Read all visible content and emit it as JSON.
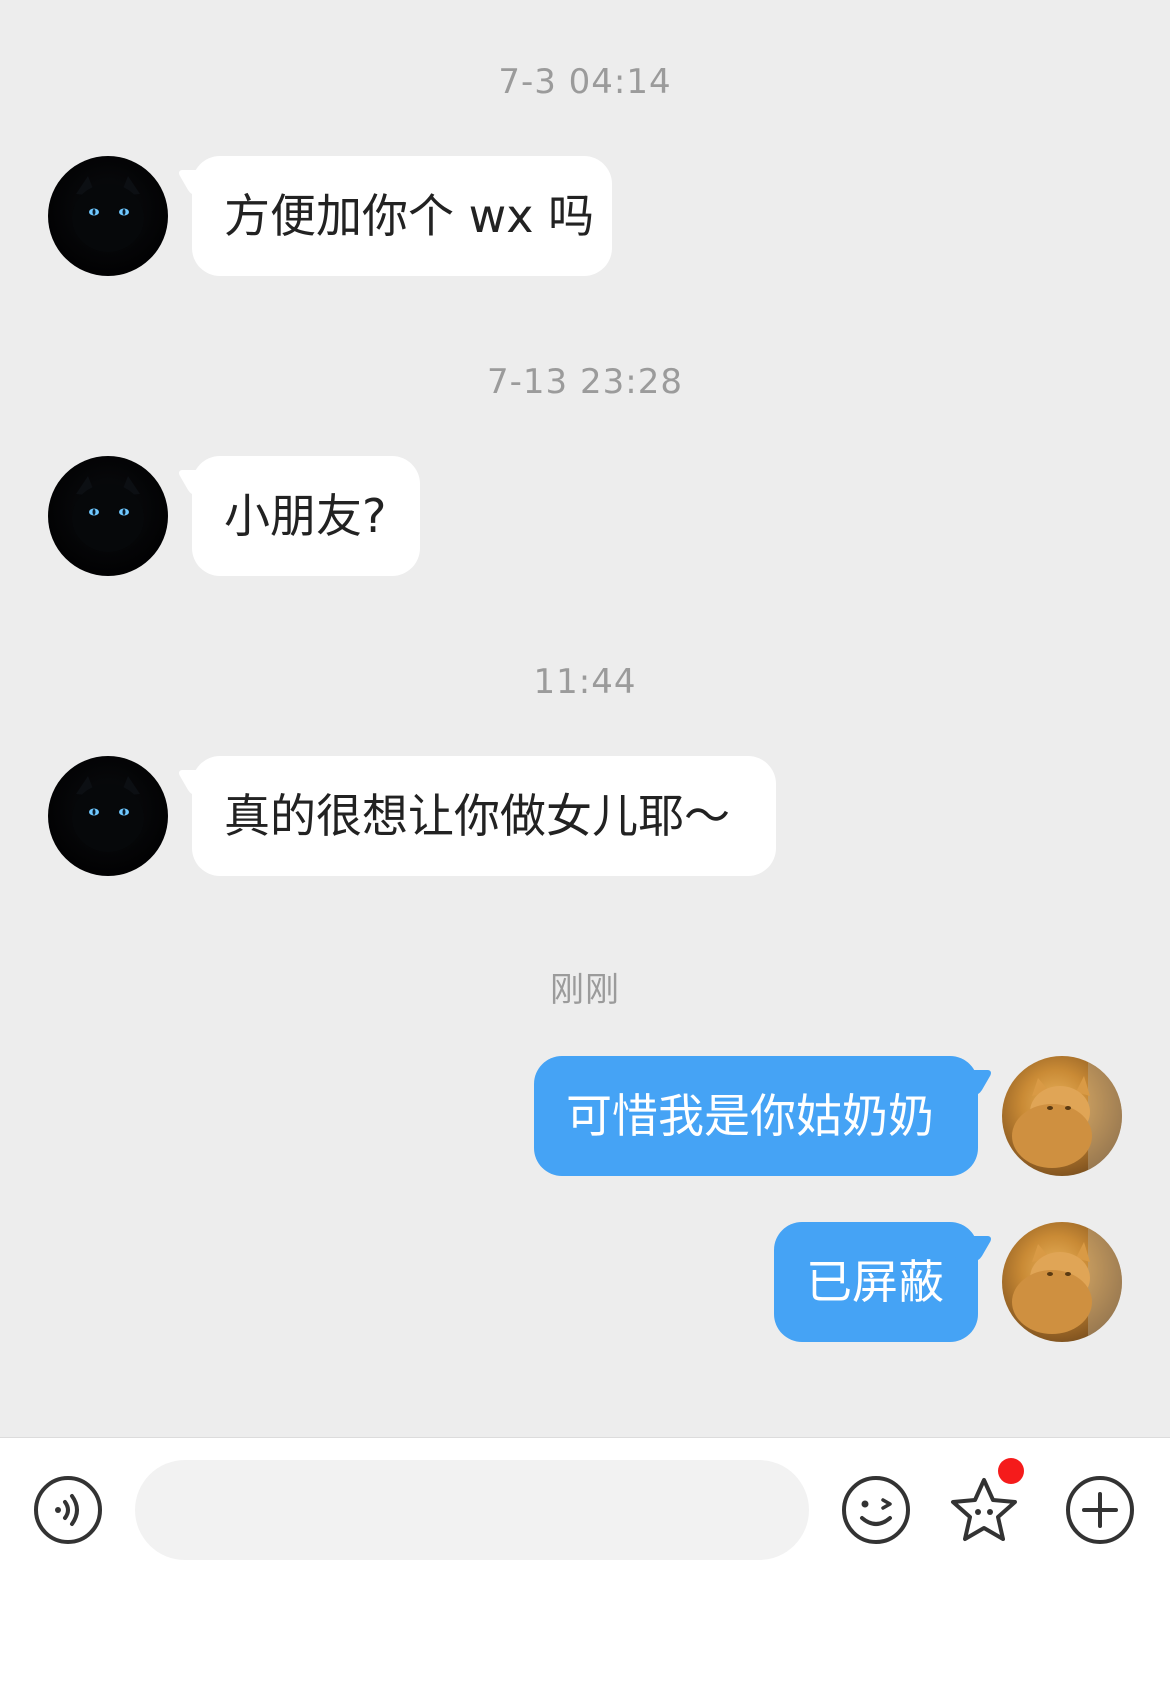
{
  "messages": [
    {
      "timestamp": "7-3 04:14",
      "side": "in",
      "text": "方便加你个 wx 吗"
    },
    {
      "timestamp": "7-13 23:28",
      "side": "in",
      "text": "小朋友?"
    },
    {
      "timestamp": "11:44",
      "side": "in",
      "text": "真的很想让你做女儿耶～"
    },
    {
      "timestamp": "刚刚",
      "side": "out",
      "text": "可惜我是你姑奶奶"
    },
    {
      "timestamp": "",
      "side": "out",
      "text": "已屏蔽"
    }
  ],
  "input": {
    "placeholder": "",
    "value": ""
  },
  "icons": {
    "voice": "voice-icon",
    "emoji": "emoji-icon",
    "sticker": "sticker-star-icon",
    "more": "plus-icon"
  },
  "colors": {
    "background": "#ededed",
    "incoming_bubble": "#ffffff",
    "outgoing_bubble": "#45a3f5",
    "notification_dot": "#f51b1b"
  }
}
